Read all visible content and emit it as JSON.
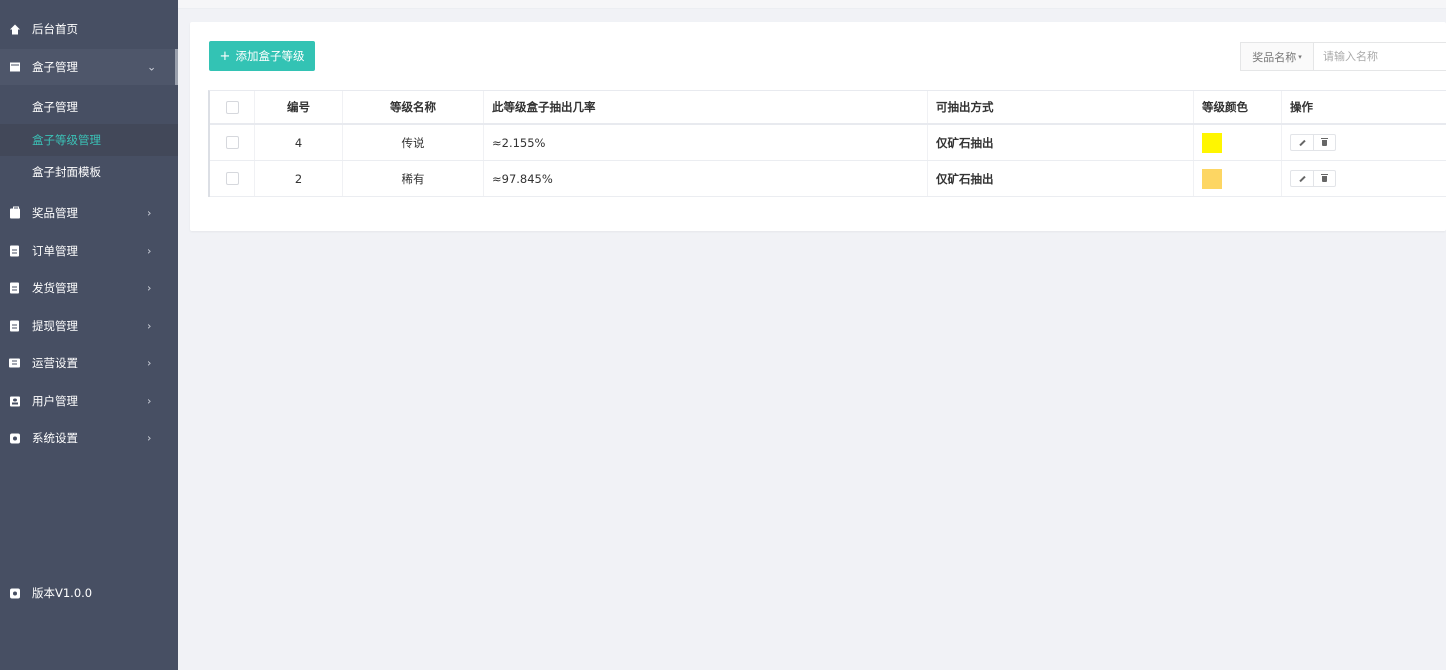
{
  "sidebar": {
    "items": [
      {
        "label": "后台首页",
        "icon": "home-icon"
      },
      {
        "label": "盒子管理",
        "icon": "archive-icon",
        "arrow": "⌄"
      },
      {
        "label": "奖品管理",
        "icon": "gift-icon",
        "arrow": "›"
      },
      {
        "label": "订单管理",
        "icon": "clipboard-icon",
        "arrow": "›"
      },
      {
        "label": "发货管理",
        "icon": "clipboard-icon",
        "arrow": "›"
      },
      {
        "label": "提现管理",
        "icon": "clipboard-icon",
        "arrow": "›"
      },
      {
        "label": "运营设置",
        "icon": "chat-icon",
        "arrow": "›"
      },
      {
        "label": "用户管理",
        "icon": "user-icon",
        "arrow": "›"
      },
      {
        "label": "系统设置",
        "icon": "gear-icon",
        "arrow": "›"
      }
    ],
    "submenu": [
      {
        "label": "盒子管理"
      },
      {
        "label": "盒子等级管理"
      },
      {
        "label": "盒子封面模板"
      }
    ],
    "version": "版本V1.0.0"
  },
  "toolbar": {
    "add_button": "添加盒子等级",
    "add_plus": "+",
    "search_select": "奖品名称",
    "search_caret": "▾",
    "search_placeholder": "请输入名称"
  },
  "table": {
    "headers": [
      "编号",
      "等级名称",
      "此等级盒子抽出几率",
      "可抽出方式",
      "等级颜色",
      "操作"
    ],
    "rows": [
      {
        "id": "4",
        "name": "传说",
        "rate": "≈2.155%",
        "method": "仅矿石抽出",
        "color": "#fff600"
      },
      {
        "id": "2",
        "name": "稀有",
        "rate": "≈97.845%",
        "method": "仅矿石抽出",
        "color": "#fdd663"
      }
    ]
  },
  "colors": {
    "sidebar_bg": "#474f63",
    "accent": "#33c3b4",
    "active_text": "#3bc1b6"
  }
}
